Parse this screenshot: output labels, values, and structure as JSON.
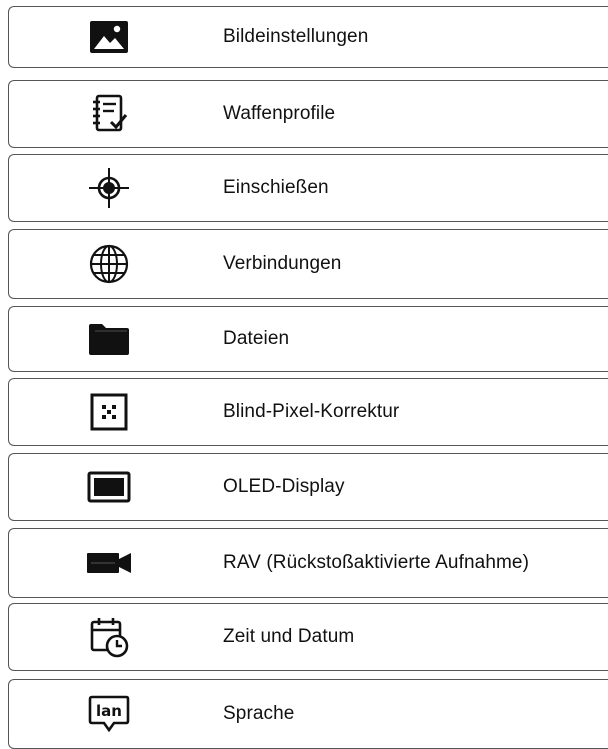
{
  "menu": {
    "items": [
      {
        "label": "Bildeinstellungen",
        "icon": "image-icon"
      },
      {
        "label": "Waffenprofile",
        "icon": "notebook-check-icon"
      },
      {
        "label": "Einschießen",
        "icon": "crosshair-icon"
      },
      {
        "label": "Verbindungen",
        "icon": "globe-icon"
      },
      {
        "label": "Dateien",
        "icon": "folder-icon"
      },
      {
        "label": "Blind-Pixel-Korrektur",
        "icon": "pixel-grid-icon"
      },
      {
        "label": "OLED-Display",
        "icon": "display-icon"
      },
      {
        "label": "RAV (Rückstoßaktivierte Aufnahme)",
        "icon": "video-camera-icon"
      },
      {
        "label": "Zeit und Datum",
        "icon": "calendar-clock-icon"
      },
      {
        "label": "Sprache",
        "icon": "language-icon"
      }
    ]
  }
}
